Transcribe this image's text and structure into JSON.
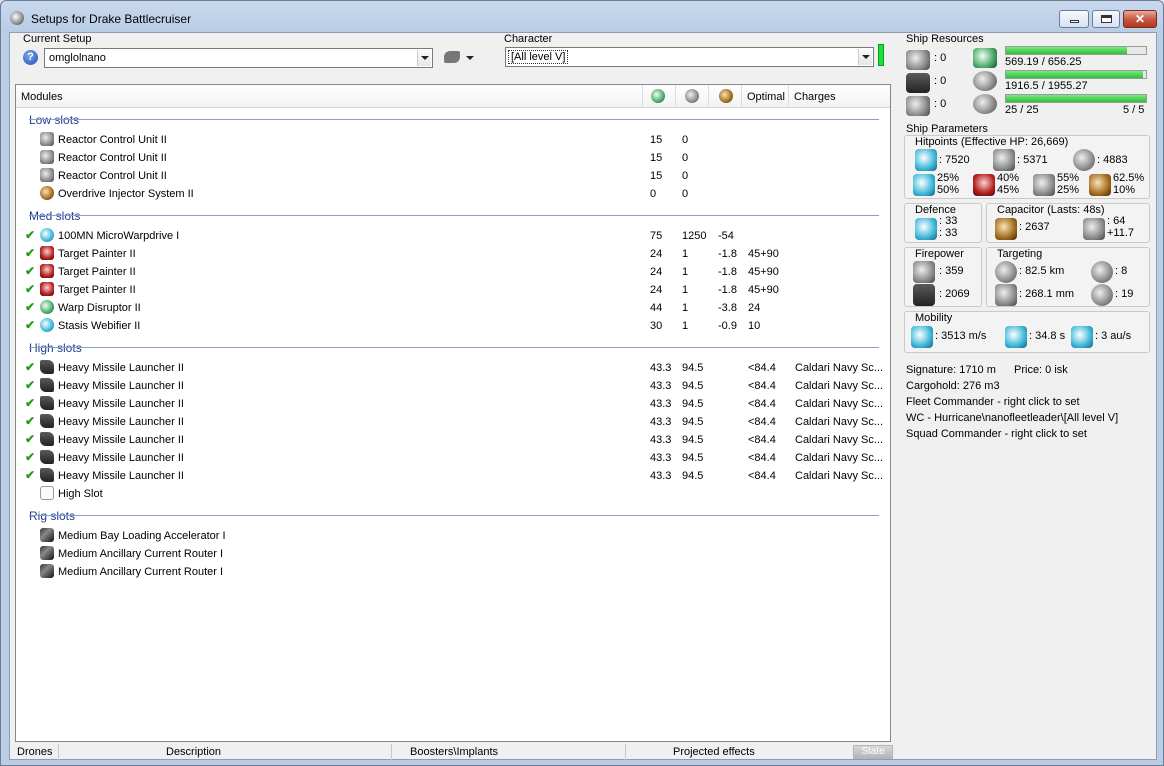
{
  "window": {
    "title": "Setups for Drake Battlecruiser"
  },
  "setup": {
    "label": "Current Setup",
    "value": "omglolnano",
    "help_glyph": "?"
  },
  "character": {
    "label": "Character",
    "value": "[All level V]"
  },
  "columns": {
    "modules": "Modules",
    "optimal": "Optimal",
    "charges": "Charges"
  },
  "sections": {
    "low": "Low slots",
    "med": "Med slots",
    "high": "High slots",
    "rig": "Rig slots"
  },
  "low_slots": [
    {
      "name": "Reactor Control Unit II",
      "cpu": "15",
      "pg": "0"
    },
    {
      "name": "Reactor Control Unit II",
      "cpu": "15",
      "pg": "0"
    },
    {
      "name": "Reactor Control Unit II",
      "cpu": "15",
      "pg": "0"
    },
    {
      "name": "Overdrive Injector System II",
      "cpu": "0",
      "pg": "0"
    }
  ],
  "med_slots": [
    {
      "name": "100MN MicroWarpdrive I",
      "cpu": "75",
      "pg": "1250",
      "cap": "-54",
      "optimal": ""
    },
    {
      "name": "Target Painter II",
      "cpu": "24",
      "pg": "1",
      "cap": "-1.8",
      "optimal": "45+90"
    },
    {
      "name": "Target Painter II",
      "cpu": "24",
      "pg": "1",
      "cap": "-1.8",
      "optimal": "45+90"
    },
    {
      "name": "Target Painter II",
      "cpu": "24",
      "pg": "1",
      "cap": "-1.8",
      "optimal": "45+90"
    },
    {
      "name": "Warp Disruptor II",
      "cpu": "44",
      "pg": "1",
      "cap": "-3.8",
      "optimal": "24"
    },
    {
      "name": "Stasis Webifier II",
      "cpu": "30",
      "pg": "1",
      "cap": "-0.9",
      "optimal": "10"
    }
  ],
  "high_slots": [
    {
      "name": "Heavy Missile Launcher II",
      "cpu": "43.3",
      "pg": "94.5",
      "optimal": "<84.4",
      "charge": "Caldari Navy Sc..."
    },
    {
      "name": "Heavy Missile Launcher II",
      "cpu": "43.3",
      "pg": "94.5",
      "optimal": "<84.4",
      "charge": "Caldari Navy Sc..."
    },
    {
      "name": "Heavy Missile Launcher II",
      "cpu": "43.3",
      "pg": "94.5",
      "optimal": "<84.4",
      "charge": "Caldari Navy Sc..."
    },
    {
      "name": "Heavy Missile Launcher II",
      "cpu": "43.3",
      "pg": "94.5",
      "optimal": "<84.4",
      "charge": "Caldari Navy Sc..."
    },
    {
      "name": "Heavy Missile Launcher II",
      "cpu": "43.3",
      "pg": "94.5",
      "optimal": "<84.4",
      "charge": "Caldari Navy Sc..."
    },
    {
      "name": "Heavy Missile Launcher II",
      "cpu": "43.3",
      "pg": "94.5",
      "optimal": "<84.4",
      "charge": "Caldari Navy Sc..."
    },
    {
      "name": "Heavy Missile Launcher II",
      "cpu": "43.3",
      "pg": "94.5",
      "optimal": "<84.4",
      "charge": "Caldari Navy Sc..."
    }
  ],
  "empty_high": "High Slot",
  "rig_slots": [
    {
      "name": "Medium Bay Loading Accelerator I"
    },
    {
      "name": "Medium Ancillary Current Router I"
    },
    {
      "name": "Medium Ancillary Current Router I"
    }
  ],
  "tabs": [
    "Drones",
    "Description",
    "Boosters\\Implants",
    "Projected effects"
  ],
  "state_button": "State",
  "resources": {
    "title": "Ship Resources",
    "hardpoints": [
      ": 0",
      ": 0",
      ": 0"
    ],
    "cpu": {
      "text": "569.19 / 656.25",
      "fraction": 0.867
    },
    "powergrid": {
      "text": "1916.5 / 1955.27",
      "fraction": 0.98
    },
    "calibration": {
      "text": "25 / 25",
      "fraction": 1.0
    },
    "drones_text": "5 / 5"
  },
  "params": {
    "title": "Ship Parameters",
    "hp_title": "Hitpoints (Effective HP: 26,669)",
    "shield": ": 7520",
    "armor": ": 5371",
    "structure": ": 4883",
    "resists": [
      {
        "a": "25%",
        "b": "50%"
      },
      {
        "a": "40%",
        "b": "45%"
      },
      {
        "a": "55%",
        "b": "25%"
      },
      {
        "a": "62.5%",
        "b": "10%"
      }
    ],
    "defence": {
      "title": "Defence",
      "a": ": 33",
      "b": ": 33"
    },
    "capacitor": {
      "title": "Capacitor (Lasts: 48s)",
      "amount": ": 2637",
      "recharge_a": ": 64",
      "recharge_b": "+11.7"
    },
    "firepower": {
      "title": "Firepower",
      "a": ": 359",
      "b": ": 2069"
    },
    "targeting": {
      "title": "Targeting",
      "range": ": 82.5 km",
      "targets": ": 8",
      "res": ": 268.1 mm",
      "scan": ": 19"
    },
    "mobility": {
      "title": "Mobility",
      "speed": ": 3513 m/s",
      "align": ": 34.8 s",
      "warp": ": 3 au/s"
    }
  },
  "info": {
    "signature": "Signature: 1710 m",
    "price": "Price: 0 isk",
    "cargo": "Cargohold: 276 m3",
    "fleet": "Fleet Commander - right click to set",
    "wing": "WC - Hurricane\\nanofleetleader\\[All level V]",
    "squad": "Squad Commander - right click to set"
  }
}
